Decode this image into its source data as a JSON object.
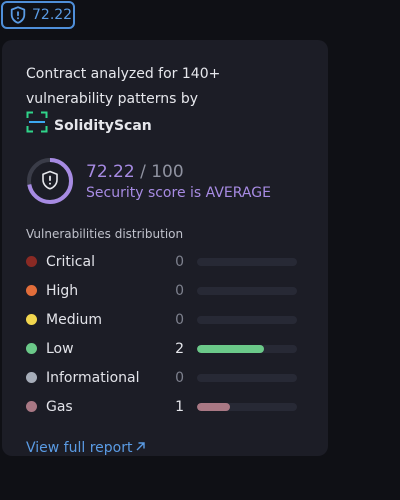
{
  "badge": {
    "score": "72.22",
    "icon": "shield-alert-icon",
    "color": "#5a9be4"
  },
  "card": {
    "intro_text": "Contract analyzed for 140+ vulnerability patterns by",
    "brand_name": "SolidityScan",
    "brand_icon": "scan-frame-icon",
    "score": {
      "value": "72.22",
      "separator_max": "/ 100",
      "status_text": "Security score is AVERAGE",
      "fraction": 0.7222,
      "accent_color": "#a78be3"
    },
    "distribution": {
      "title": "Vulnerabilities distribution",
      "max_count": 3,
      "items": [
        {
          "label": "Critical",
          "count": "0",
          "color": "#8a2a24",
          "bar_color": "#8a2a24"
        },
        {
          "label": "High",
          "count": "0",
          "color": "#e26d3a",
          "bar_color": "#e26d3a"
        },
        {
          "label": "Medium",
          "count": "0",
          "color": "#f2d64e",
          "bar_color": "#f2d64e"
        },
        {
          "label": "Low",
          "count": "2",
          "color": "#6bc989",
          "bar_color": "#6bc989"
        },
        {
          "label": "Informational",
          "count": "0",
          "color": "#a6adb9",
          "bar_color": "#a6adb9"
        },
        {
          "label": "Gas",
          "count": "1",
          "color": "#a97884",
          "bar_color": "#a97884"
        }
      ]
    },
    "report_link": {
      "label": "View full report",
      "icon": "arrow-up-right-icon",
      "color": "#5a9be4"
    }
  }
}
